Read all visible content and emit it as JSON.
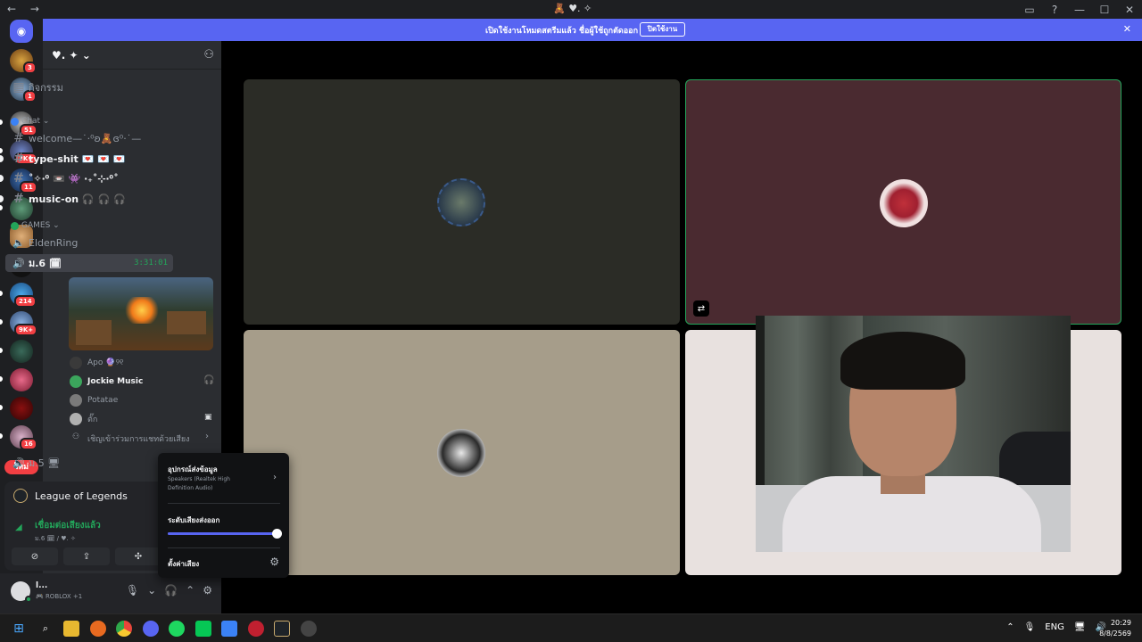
{
  "titlebar": {
    "nav": "← →",
    "title": "🧸 ♥︎. ✧",
    "controls": [
      "▭",
      "?",
      "—",
      "☐",
      "✕"
    ]
  },
  "banner": {
    "text": "เปิดใช้งานโหมดสตรีมแล้ว ชื่อผู้ใช้ถูกตัดออก",
    "button": "ปิดใช้งาน",
    "close": "✕"
  },
  "servers": {
    "badges": [
      "3",
      "1",
      "51",
      "3K+",
      "11",
      "214",
      "9K+",
      "16"
    ],
    "new_label": "ใหม่"
  },
  "guild": {
    "name": "♥︎. ✦ ⌄",
    "activity_label": "กิจกรรม",
    "categories": [
      {
        "name": "Chat ⌄",
        "color": "#3b82f6"
      },
      {
        "name": "GAMES ⌄",
        "color": "#23a55a"
      }
    ],
    "channels": [
      {
        "name": "welcome—˙‧⁰ʚ🧸ɞ⁰‧˙—",
        "icon": "#"
      },
      {
        "name": "type-shit 💌 💌 💌",
        "icon": "#"
      },
      {
        "name": "˚✧‧⁰ 📼 👾 ‧₊˚⊹‧⁰˚",
        "icon": "#"
      },
      {
        "name": "music-on 🎧 🎧 🎧",
        "icon": "#"
      },
      {
        "name": "EldenRing",
        "icon": "🔈"
      },
      {
        "name": "ม.6 🗓",
        "icon": "🔊",
        "timer": "3:31:01"
      },
      {
        "name": "ม.5 🖥",
        "icon": "🔊"
      }
    ],
    "voice_users": [
      {
        "name": "Apo 🔮୨୧"
      },
      {
        "name": "Jockie Music"
      },
      {
        "name": "Potatae"
      },
      {
        "name": "ตั๊ก"
      },
      {
        "name": "เชิญเข้าร่วมการแชทด้วยเสียง"
      }
    ],
    "voice_user_end_icons": [
      "🎧",
      "▣",
      "›"
    ]
  },
  "activity": {
    "game": "League of Legends",
    "connected": "เชื่อมต่อเสียงแล้ว",
    "channel_path": "ม.6 🗓 / ♥︎. ✧",
    "buttons": [
      "⊘",
      "⇪",
      "✣",
      "✚"
    ]
  },
  "user": {
    "name": "l...",
    "status": "🎮 ROBLOX +1",
    "controls": [
      "🎙",
      "⌄",
      "🎧",
      "⌃",
      "⚙"
    ]
  },
  "output_popup": {
    "title": "อุปกรณ์ส่งข้อมูล",
    "device": "Speakers (Realtek High Definition Audio)",
    "arrow": "›",
    "volume_label": "ระดับเสียงส่งออก",
    "volume_level": 1.0,
    "settings_label": "ตั้งค่าเสียง",
    "settings_icon": "⚙"
  },
  "tiles": [
    {
      "bg": "#2b2c26",
      "border": "none"
    },
    {
      "bg": "#4a2a30",
      "border": "#23a55a"
    },
    {
      "bg": "#a69d8a",
      "border": "none"
    },
    {
      "bg": "#e8e1df",
      "border": "none"
    }
  ],
  "taskbar": {
    "tray": [
      "⌃",
      "🎙",
      "ENG",
      "🖥",
      "🔊"
    ],
    "time": "20:29",
    "date": "8/8/2569"
  }
}
